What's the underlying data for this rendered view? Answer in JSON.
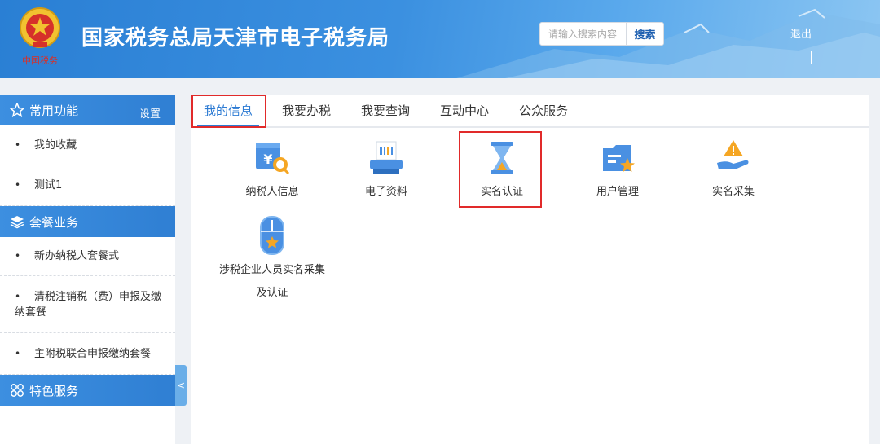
{
  "header": {
    "title": "国家税务总局天津市电子税务局",
    "emblem_text": "中国税务",
    "search_placeholder": "请输入搜索内容",
    "search_button": "搜索",
    "logout": "退出"
  },
  "sidebar": {
    "sections": [
      {
        "title": "常用功能",
        "icon": "star-icon",
        "action": "设置",
        "items": [
          "我的收藏",
          "测试1"
        ]
      },
      {
        "title": "套餐业务",
        "icon": "layers-icon",
        "items": [
          "新办纳税人套餐式",
          "清税注销税（费）申报及缴纳套餐",
          "主附税联合申报缴纳套餐"
        ]
      },
      {
        "title": "特色服务",
        "icon": "grid-icon",
        "items": []
      }
    ],
    "bullet": "•",
    "collapse": "<"
  },
  "tabs": [
    "我的信息",
    "我要办税",
    "我要查询",
    "互动中心",
    "公众服务"
  ],
  "tiles": [
    {
      "label": "纳税人信息",
      "icon": "taxpayer-info-icon"
    },
    {
      "label": "电子资料",
      "icon": "electronic-data-icon"
    },
    {
      "label": "实名认证",
      "icon": "hourglass-icon"
    },
    {
      "label": "用户管理",
      "icon": "user-management-icon"
    },
    {
      "label": "实名采集",
      "icon": "warning-hand-icon"
    },
    {
      "label_line1": "涉税企业人员实名采集",
      "label_line2": "及认证",
      "icon": "mouse-star-icon"
    }
  ],
  "icon_glyphs": {
    "yuan": "¥"
  },
  "colors": {
    "header_blue": "#2a7fd4",
    "accent": "#2d7bd3",
    "highlight_red": "#e12a2a",
    "icon_orange": "#f5a623"
  }
}
